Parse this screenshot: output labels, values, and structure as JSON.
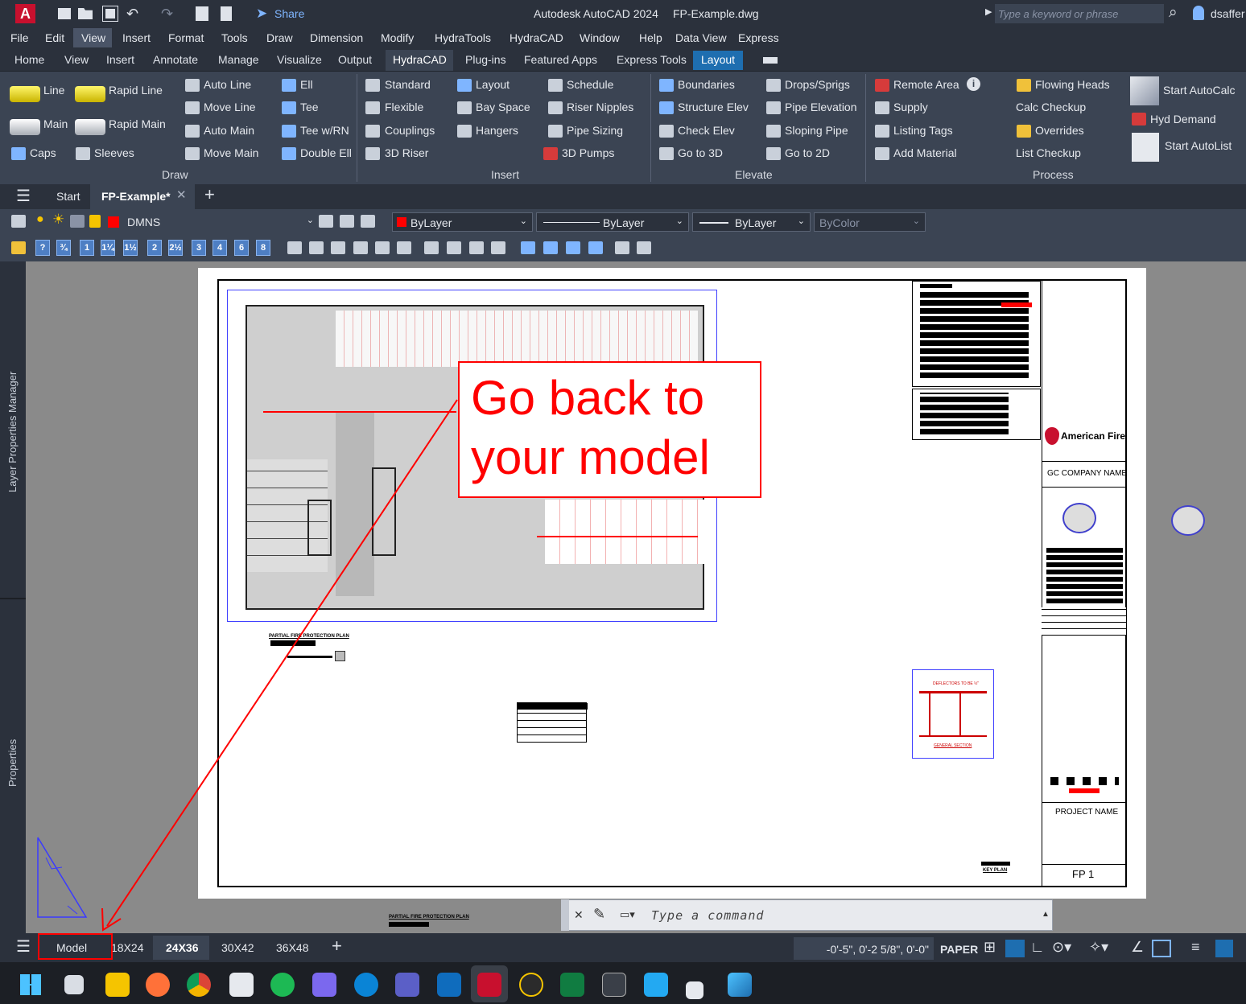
{
  "app": {
    "logo": "A",
    "title": "Autodesk AutoCAD 2024",
    "filename": "FP-Example.dwg",
    "share": "Share",
    "search_placeholder": "Type a keyword or phrase",
    "user": "dsaffer"
  },
  "menu": [
    "File",
    "Edit",
    "View",
    "Insert",
    "Format",
    "Tools",
    "Draw",
    "Dimension",
    "Modify",
    "HydraTools",
    "HydraCAD",
    "Window",
    "Help",
    "Data View",
    "Express"
  ],
  "ribbon_tabs": [
    "Home",
    "View",
    "Insert",
    "Annotate",
    "Manage",
    "Visualize",
    "Output",
    "HydraCAD",
    "Plug-ins",
    "Featured Apps",
    "Express Tools",
    "Layout"
  ],
  "ribbon": {
    "draw": {
      "line": "Line",
      "rapid_line": "Rapid Line",
      "main": "Main",
      "rapid_main": "Rapid Main",
      "caps": "Caps",
      "sleeves": "Sleeves",
      "auto_line": "Auto Line",
      "move_line": "Move Line",
      "auto_main": "Auto Main",
      "move_main": "Move Main",
      "ell": "Ell",
      "tee": "Tee",
      "tee_wrn": "Tee w/RN",
      "double_ell": "Double Ell",
      "title": "Draw"
    },
    "insert": {
      "standard": "Standard",
      "flexible": "Flexible",
      "couplings": "Couplings",
      "riser3d": "3D Riser",
      "layout": "Layout",
      "bay_space": "Bay Space",
      "hangers": "Hangers",
      "schedule": "Schedule",
      "riser_nipples": "Riser Nipples",
      "pipe_sizing": "Pipe Sizing",
      "pumps3d": "3D Pumps",
      "title": "Insert"
    },
    "elevate": {
      "boundaries": "Boundaries",
      "structure_elev": "Structure Elev",
      "check_elev": "Check Elev",
      "go3d": "Go to 3D",
      "drops": "Drops/Sprigs",
      "pipe_elevation": "Pipe Elevation",
      "sloping_pipe": "Sloping Pipe",
      "go2d": "Go to 2D",
      "title": "Elevate"
    },
    "process": {
      "remote_area": "Remote Area",
      "supply": "Supply",
      "listing_tags": "Listing Tags",
      "add_material": "Add Material",
      "flowing_heads": "Flowing Heads",
      "calc_checkup": "Calc Checkup",
      "overrides": "Overrides",
      "list_checkup": "List Checkup",
      "start_autocalc": "Start AutoCalc",
      "hyd_demand": "Hyd Demand",
      "start_autolist": "Start AutoList",
      "title": "Process"
    }
  },
  "filetabs": {
    "start": "Start",
    "active": "FP-Example*"
  },
  "properties": {
    "layer": "DMNS",
    "color": "ByLayer",
    "linetype": "ByLayer",
    "lineweight": "ByLayer",
    "plotstyle": "ByColor"
  },
  "layer_toolbar_numbers": [
    "?",
    "¾",
    "1",
    "1¼",
    "1½",
    "2",
    "2½",
    "3",
    "4",
    "6",
    "8"
  ],
  "palettes": {
    "layer_props": "Layer Properties Manager",
    "properties": "Properties"
  },
  "drawing": {
    "plan_title": "PARTIAL FIRE PROTECTION PLAN",
    "company": "American Fire",
    "gc_name": "GC COMPANY NAME",
    "project_name": "PROJECT NAME",
    "sheet": "FP 1",
    "key_plan": "KEY PLAN",
    "deflectors": "DEFLECTORS TO BE ½\"",
    "general_section": "GENERAL SECTION"
  },
  "callout": {
    "line1": "Go back to",
    "line2": "your model",
    "color": "#ff0000"
  },
  "command": {
    "placeholder": "Type a command"
  },
  "status": {
    "layouts": [
      "Model",
      "18X24",
      "24X36",
      "30X42",
      "36X48"
    ],
    "active_layout": "24X36",
    "coords": "-0'-5\", 0'-2 5/8\", 0'-0\"",
    "space": "PAPER"
  }
}
